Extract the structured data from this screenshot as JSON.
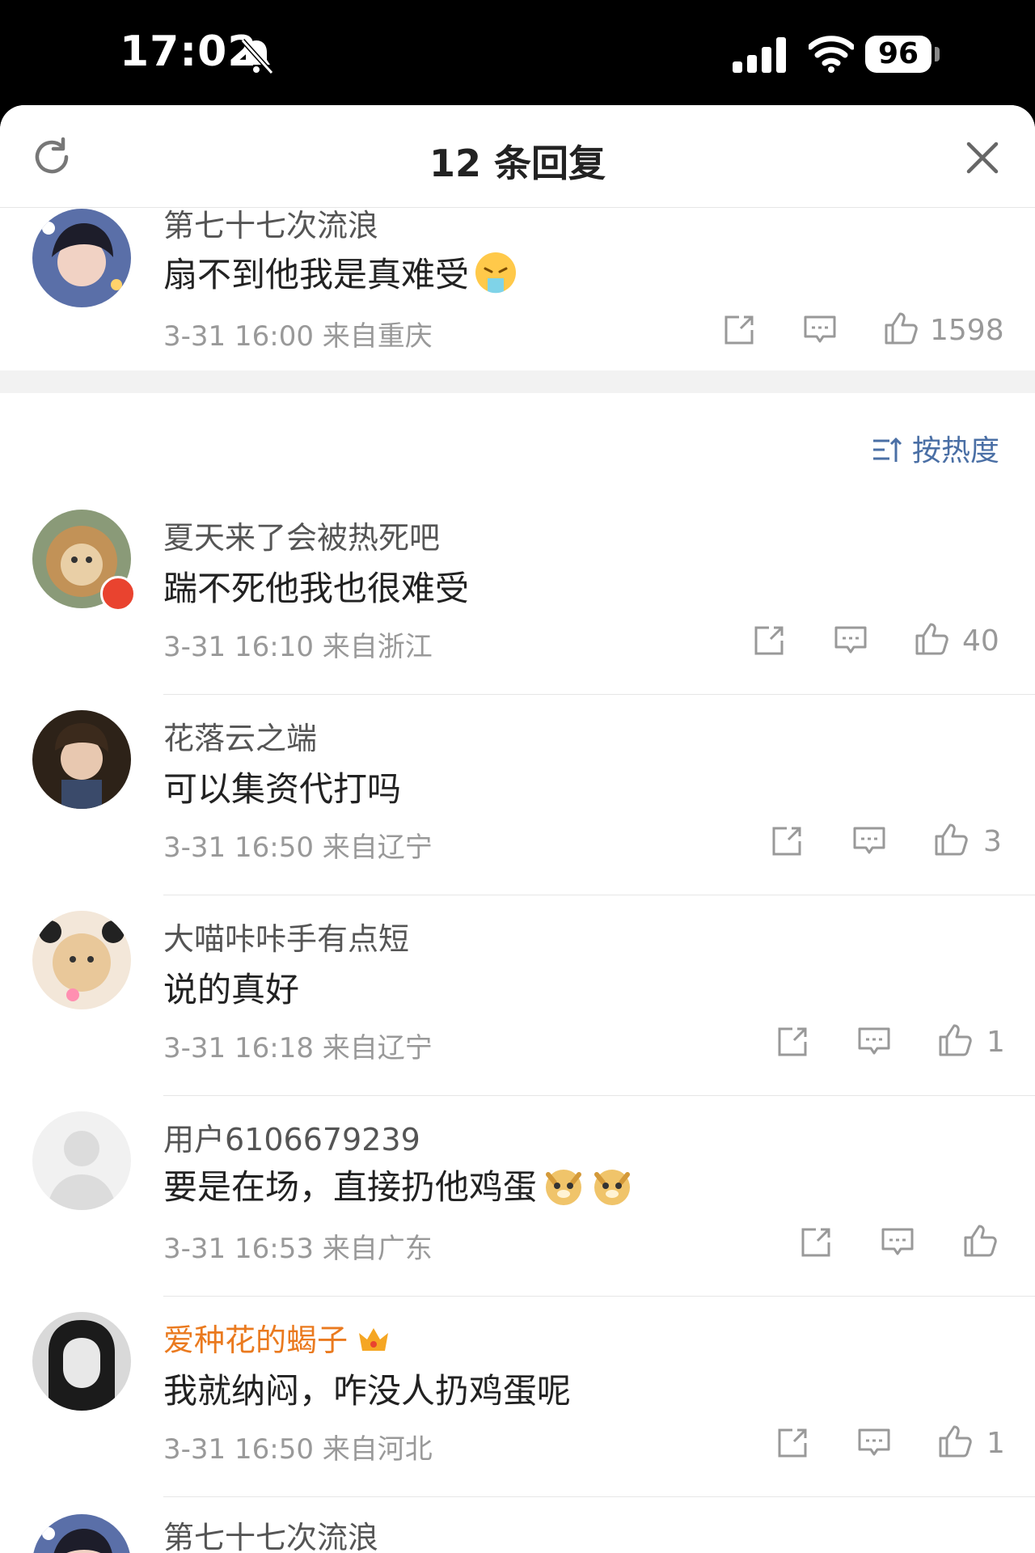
{
  "status_bar": {
    "time": "17:02",
    "battery": "96"
  },
  "header": {
    "title": "12 条回复"
  },
  "op_comment": {
    "username": "第七十七次流浪",
    "text": "扇不到他我是真难受",
    "meta": "3-31 16:00  来自重庆",
    "likes": "1598"
  },
  "sort": {
    "label": "按热度"
  },
  "replies": [
    {
      "username": "夏天来了会被热死吧",
      "text": "踹不死他我也很难受",
      "meta": "3-31 16:10  来自浙江",
      "likes": "40"
    },
    {
      "username": "花落云之端",
      "text": "可以集资代打吗",
      "meta": "3-31 16:50  来自辽宁",
      "likes": "3"
    },
    {
      "username": "大喵咔咔手有点短",
      "text": "说的真好",
      "meta": "3-31 16:18  来自辽宁",
      "likes": "1"
    },
    {
      "username": "用户6106679239",
      "text": "要是在场，直接扔他鸡蛋",
      "meta": "3-31 16:53  来自广东",
      "likes": ""
    },
    {
      "username": "爱种花的蝎子",
      "text": "我就纳闷，咋没人扔鸡蛋呢",
      "meta": "3-31 16:50  来自河北",
      "likes": "1"
    },
    {
      "username": "第七十七次流浪",
      "text": "",
      "meta": "",
      "likes": ""
    }
  ],
  "colors": {
    "vip_name": "#ea7a1f",
    "sort_link": "#4a6fa5",
    "meta_gray": "#999999"
  }
}
